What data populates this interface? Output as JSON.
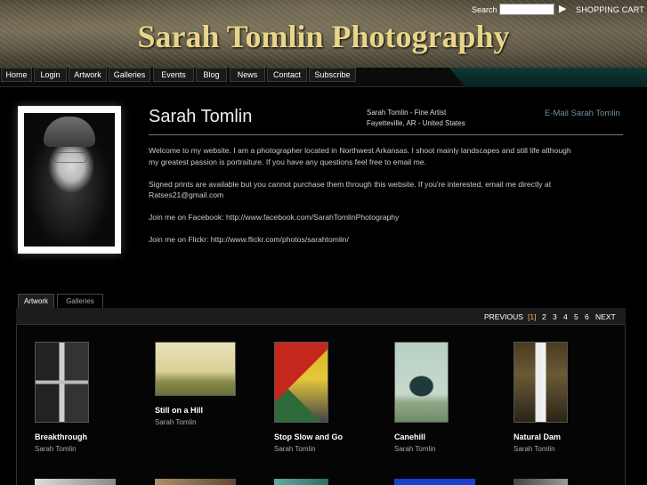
{
  "site": {
    "title": "Sarah Tomlin Photography"
  },
  "nav": {
    "items": [
      "Home",
      "Login",
      "Artwork",
      "Galleries",
      "Events",
      "Blog",
      "News",
      "Contact",
      "Subscribe"
    ],
    "search_label": "Search",
    "search_value": "",
    "cart_label": "SHOPPING CART"
  },
  "profile": {
    "name": "Sarah Tomlin",
    "subtitle": "Sarah Tomlin - Fine Artist",
    "location": "Fayetteville, AR - United States",
    "email_link": "E-Mail Sarah Tomlin",
    "bio": [
      "Welcome to my website. I am a photographer located in Northwest Arkansas. I shoot mainly landscapes and still life although",
      "my greatest passion is portraiture. If you have any questions feel free to email me.",
      "",
      "Signed prints are available but you cannot purchase them through this website. If you're interested, email me directly at",
      "Ratses21@gmail.com",
      "",
      "Join me on Facebook: http://www.facebook.com/SarahTomlinPhotography",
      "",
      "Join me on Flickr: http://www.flickr.com/photos/sarahtomlin/"
    ]
  },
  "tabs": [
    "Artwork",
    "Galleries"
  ],
  "pager": {
    "prev": "PREVIOUS",
    "current": "[1]",
    "pages": [
      "2",
      "3",
      "4",
      "5",
      "6"
    ],
    "next": "NEXT"
  },
  "artwork": [
    {
      "title": "Breakthrough",
      "artist": "Sarah Tomlin"
    },
    {
      "title": "Still on a Hill",
      "artist": "Sarah Tomlin"
    },
    {
      "title": "Stop Slow and Go",
      "artist": "Sarah Tomlin"
    },
    {
      "title": "Canehill",
      "artist": "Sarah Tomlin"
    },
    {
      "title": "Natural Dam",
      "artist": "Sarah Tomlin"
    }
  ]
}
